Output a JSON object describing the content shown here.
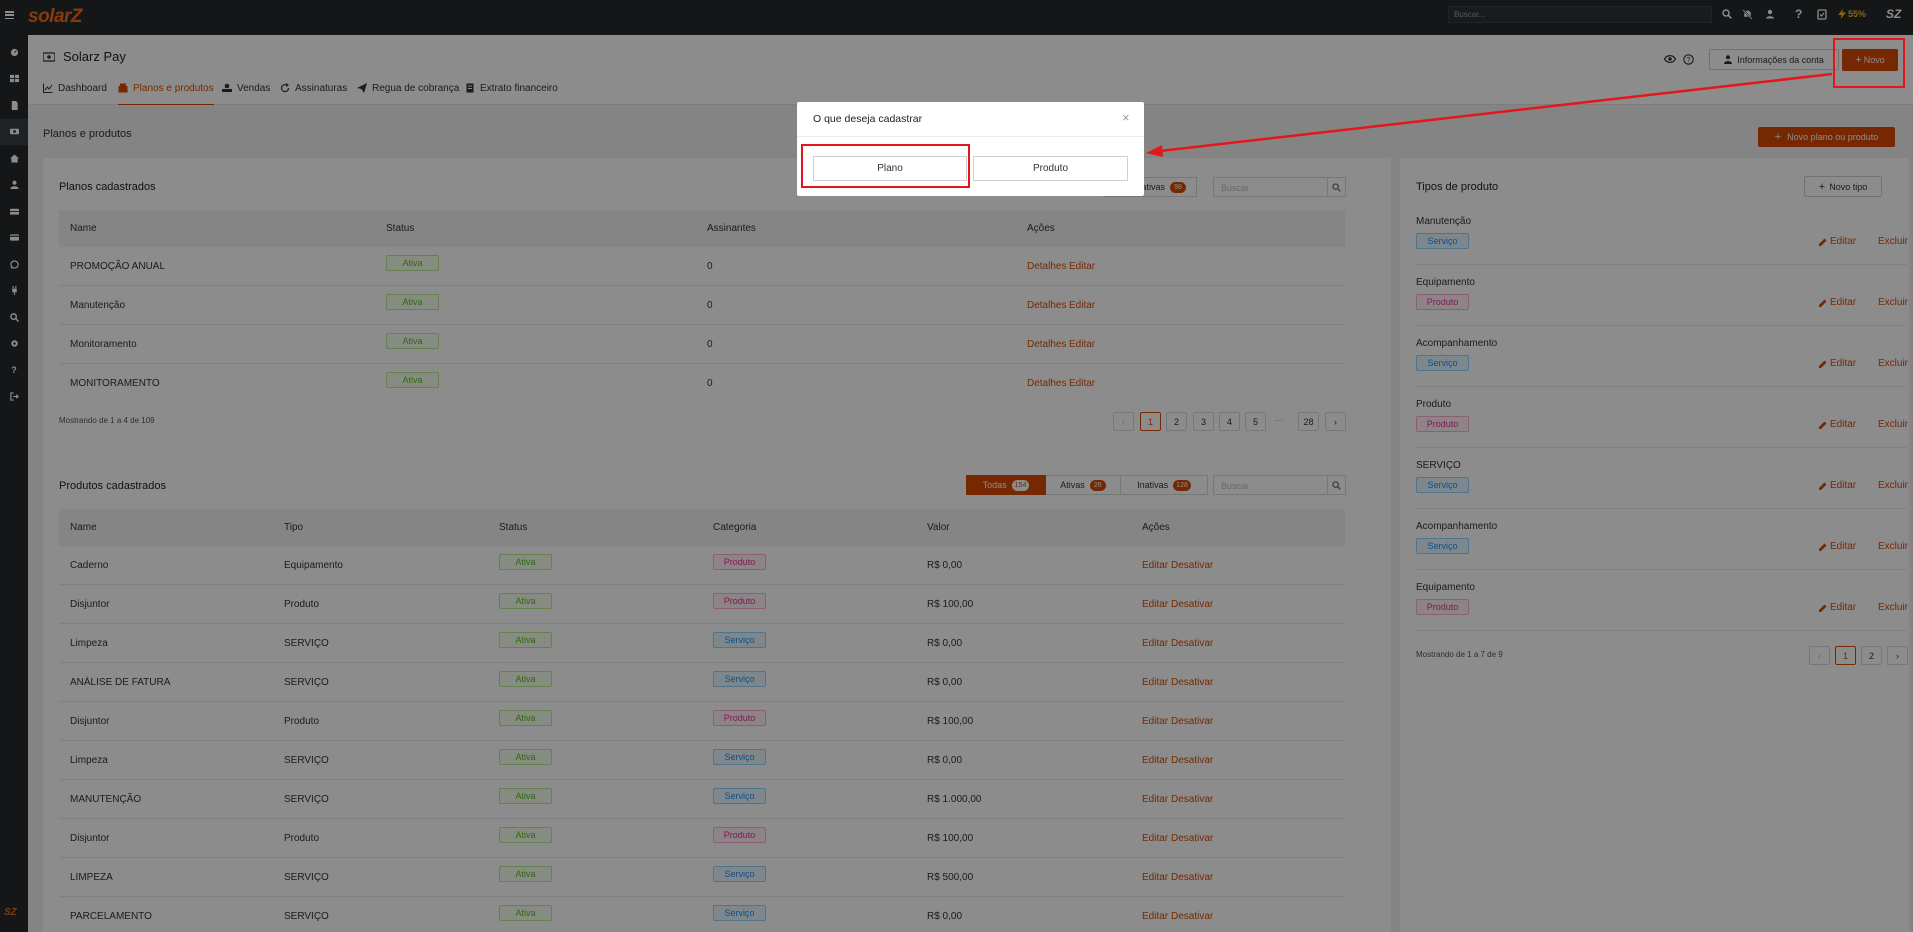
{
  "topbar": {
    "logo": "solarZ",
    "search_placeholder": "Buscar...",
    "battery": "55%"
  },
  "sidebar": {
    "brand": "SZ"
  },
  "header": {
    "title": "Solarz Pay",
    "account_button": "Informações da conta",
    "new_button": "Novo",
    "tabs": [
      {
        "label": "Dashboard",
        "icon": "chart-icon"
      },
      {
        "label": "Planos e produtos",
        "icon": "box-icon"
      },
      {
        "label": "Vendas",
        "icon": "hand-icon"
      },
      {
        "label": "Assinaturas",
        "icon": "refresh-icon"
      },
      {
        "label": "Regua de cobrança",
        "icon": "send-icon"
      },
      {
        "label": "Extrato financeiro",
        "icon": "receipt-icon"
      }
    ]
  },
  "section": {
    "title": "Planos e produtos",
    "new_button": "Novo plano ou produto"
  },
  "plans": {
    "title": "Planos cadastrados",
    "filter_inactive": "Inativas",
    "filter_inactive_count": "98",
    "search_placeholder": "Buscar",
    "columns": [
      "Name",
      "Status",
      "Assinantes",
      "Ações"
    ],
    "rows": [
      {
        "name": "PROMOÇÃO ANUAL",
        "status": "Ativa",
        "subs": "0",
        "a1": "Detalhes",
        "a2": "Editar"
      },
      {
        "name": "Manutenção",
        "status": "Ativa",
        "subs": "0",
        "a1": "Detalhes",
        "a2": "Editar"
      },
      {
        "name": "Monitoramento",
        "status": "Ativa",
        "subs": "0",
        "a1": "Detalhes",
        "a2": "Editar"
      },
      {
        "name": "MONITORAMENTO",
        "status": "Ativa",
        "subs": "0",
        "a1": "Detalhes",
        "a2": "Editar"
      }
    ],
    "showing": "Mostrando de 1 a 4 de 109",
    "pages": [
      "1",
      "2",
      "3",
      "4",
      "5"
    ],
    "ellipsis": "···",
    "last_page": "28"
  },
  "products": {
    "title": "Produtos cadastrados",
    "filters": [
      {
        "label": "Todas",
        "count": "154"
      },
      {
        "label": "Ativas",
        "count": "26"
      },
      {
        "label": "Inativas",
        "count": "128"
      }
    ],
    "search_placeholder": "Buscar",
    "columns": [
      "Name",
      "Tipo",
      "Status",
      "Categoria",
      "Valor",
      "Ações"
    ],
    "rows": [
      {
        "name": "Caderno",
        "type": "Equipamento",
        "status": "Ativa",
        "cat": "Produto",
        "value": "R$ 0,00",
        "a1": "Editar",
        "a2": "Desativar"
      },
      {
        "name": "Disjuntor",
        "type": "Produto",
        "status": "Ativa",
        "cat": "Produto",
        "value": "R$ 100,00",
        "a1": "Editar",
        "a2": "Desativar"
      },
      {
        "name": "Limpeza",
        "type": "SERVIÇO",
        "status": "Ativa",
        "cat": "Serviço",
        "value": "R$ 0,00",
        "a1": "Editar",
        "a2": "Desativar"
      },
      {
        "name": "ANÁLISE DE FATURA",
        "type": "SERVIÇO",
        "status": "Ativa",
        "cat": "Serviço",
        "value": "R$ 0,00",
        "a1": "Editar",
        "a2": "Desativar"
      },
      {
        "name": "Disjuntor",
        "type": "Produto",
        "status": "Ativa",
        "cat": "Produto",
        "value": "R$ 100,00",
        "a1": "Editar",
        "a2": "Desativar"
      },
      {
        "name": "Limpeza",
        "type": "SERVIÇO",
        "status": "Ativa",
        "cat": "Serviço",
        "value": "R$ 0,00",
        "a1": "Editar",
        "a2": "Desativar"
      },
      {
        "name": "MANUTENÇÃO",
        "type": "SERVIÇO",
        "status": "Ativa",
        "cat": "Serviço",
        "value": "R$ 1.000,00",
        "a1": "Editar",
        "a2": "Desativar"
      },
      {
        "name": "Disjuntor",
        "type": "Produto",
        "status": "Ativa",
        "cat": "Produto",
        "value": "R$ 100,00",
        "a1": "Editar",
        "a2": "Desativar"
      },
      {
        "name": "LIMPEZA",
        "type": "SERVIÇO",
        "status": "Ativa",
        "cat": "Serviço",
        "value": "R$ 500,00",
        "a1": "Editar",
        "a2": "Desativar"
      },
      {
        "name": "PARCELAMENTO",
        "type": "SERVIÇO",
        "status": "Ativa",
        "cat": "Serviço",
        "value": "R$ 0,00",
        "a1": "Editar",
        "a2": "Desativar"
      }
    ]
  },
  "types": {
    "title": "Tipos de produto",
    "new_button": "Novo tipo",
    "rows": [
      {
        "name": "Manutenção",
        "cat": "Serviço",
        "edit": "Editar",
        "delete": "Excluir"
      },
      {
        "name": "Equipamento",
        "cat": "Produto",
        "edit": "Editar",
        "delete": "Excluir"
      },
      {
        "name": "Acompanhamento",
        "cat": "Serviço",
        "edit": "Editar",
        "delete": "Excluir"
      },
      {
        "name": "Produto",
        "cat": "Produto",
        "edit": "Editar",
        "delete": "Excluir"
      },
      {
        "name": "SERVIÇO",
        "cat": "Serviço",
        "edit": "Editar",
        "delete": "Excluir"
      },
      {
        "name": "Acompanhamento",
        "cat": "Serviço",
        "edit": "Editar",
        "delete": "Excluir"
      },
      {
        "name": "Equipamento",
        "cat": "Produto",
        "edit": "Editar",
        "delete": "Excluir"
      }
    ],
    "showing": "Mostrando de 1 a 7 de 9",
    "pages": [
      "1",
      "2"
    ]
  },
  "modal": {
    "title": "O que deseja cadastrar",
    "option_plan": "Plano",
    "option_product": "Produto"
  },
  "colors": {
    "accent": "#d84a05",
    "highlight": "#e3161c",
    "topbar": "#26292d"
  }
}
